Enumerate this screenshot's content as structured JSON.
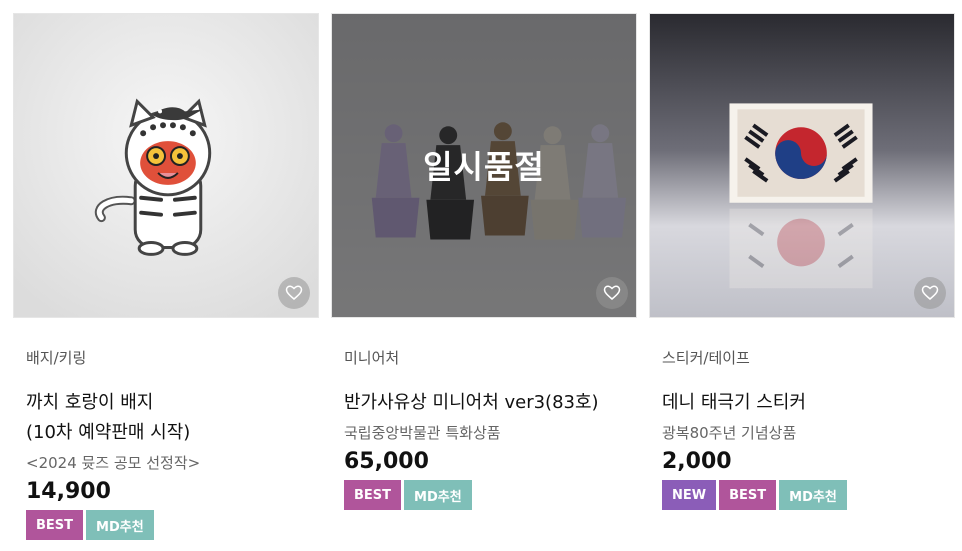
{
  "colors": {
    "best_badge": "#b0559b",
    "md_badge": "#7fbfb8",
    "new_badge": "#8b5db8",
    "soldout_overlay": "rgba(40,40,40,0.55)"
  },
  "products": [
    {
      "category": "배지/키링",
      "name_line1": "까치 호랑이 배지",
      "name_line2": "(10차 예약판매 시작)",
      "subtitle": "<2024 뮷즈 공모 선정작>",
      "price": "14,900",
      "badges": [
        "BEST",
        "MD추천"
      ],
      "image_icon": "magpie-tiger-badge-image",
      "wishlist_icon": "heart-icon"
    },
    {
      "category": "미니어처",
      "name_line1": "반가사유상 미니어처 ver3(83호)",
      "subtitle": "국립중앙박물관 특화상품",
      "price": "65,000",
      "badges": [
        "BEST",
        "MD추천"
      ],
      "soldout_label": "일시품절",
      "image_icon": "pensive-bodhisattva-miniatures-image",
      "wishlist_icon": "heart-icon"
    },
    {
      "category": "스티커/테이프",
      "name_line1": "데니 태극기 스티커",
      "subtitle": "광복80주년 기념상품",
      "price": "2,000",
      "badges": [
        "NEW",
        "BEST",
        "MD추천"
      ],
      "image_icon": "taegukgi-sticker-image",
      "wishlist_icon": "heart-icon"
    }
  ]
}
